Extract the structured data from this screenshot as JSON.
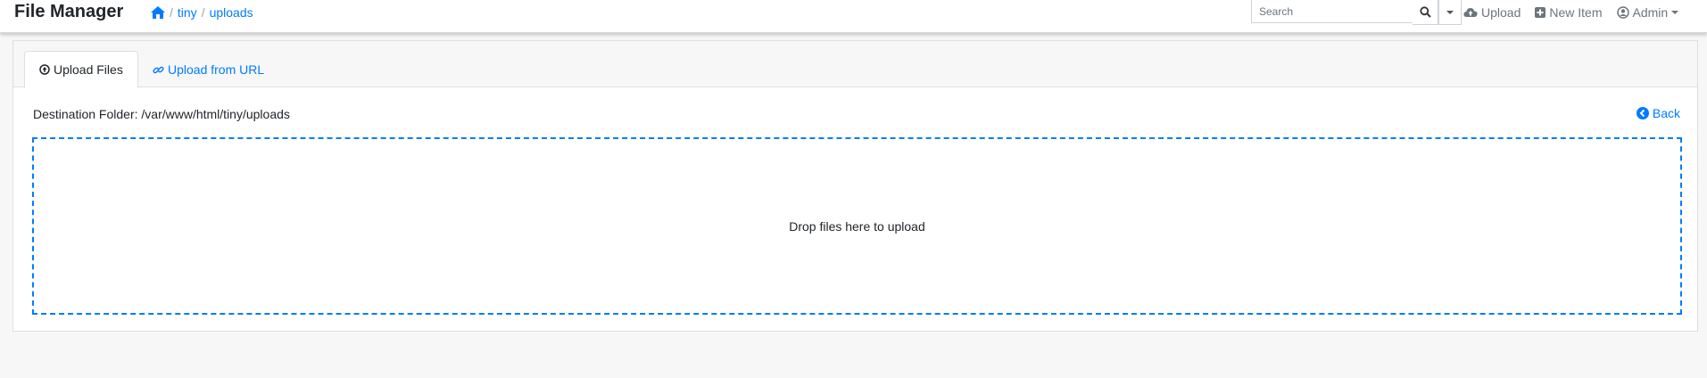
{
  "app": {
    "title": "File Manager"
  },
  "breadcrumb": {
    "items": [
      "tiny",
      "uploads"
    ],
    "separator": "/"
  },
  "search": {
    "placeholder": "Search"
  },
  "nav": {
    "upload": "Upload",
    "new_item": "New Item",
    "user": "Admin"
  },
  "tabs": [
    {
      "label": "Upload Files",
      "icon": "arrow-circle-up-icon",
      "active": true
    },
    {
      "label": "Upload from URL",
      "icon": "link-icon",
      "active": false
    }
  ],
  "destination": {
    "text": "Destination Folder: /var/www/html/tiny/uploads"
  },
  "back": {
    "label": "Back"
  },
  "dropzone": {
    "message": "Drop files here to upload"
  },
  "colors": {
    "accent": "#007bff",
    "text": "#212529",
    "muted": "#6c757d",
    "background": "#f7f7f7"
  }
}
